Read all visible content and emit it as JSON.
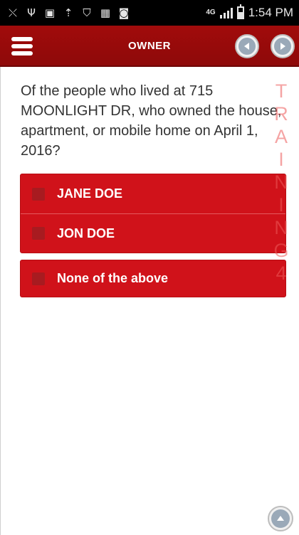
{
  "status_bar": {
    "icons": [
      "missed-call-icon",
      "usb-icon",
      "image-icon",
      "upload-icon",
      "shield-icon",
      "apps-icon",
      "camera-icon"
    ],
    "network": "4G",
    "time": "1:54 PM"
  },
  "app_bar": {
    "title": "OWNER"
  },
  "question": {
    "text": "Of the people who lived at 715 MOONLIGHT DR, who owned the house, apartment, or mobile home on April 1, 2016?"
  },
  "options": [
    {
      "label": "JANE DOE",
      "checked": false
    },
    {
      "label": "JON DOE",
      "checked": false
    }
  ],
  "none_option": {
    "label": "None of the above",
    "checked": false
  },
  "watermark": {
    "letters": [
      "T",
      "R",
      "A",
      "I",
      "N",
      "I",
      "N",
      "G",
      "4"
    ]
  },
  "colors": {
    "app_bar": "#9b0b0b",
    "option_background": "#d0121a",
    "watermark": "#ec5a5a"
  }
}
